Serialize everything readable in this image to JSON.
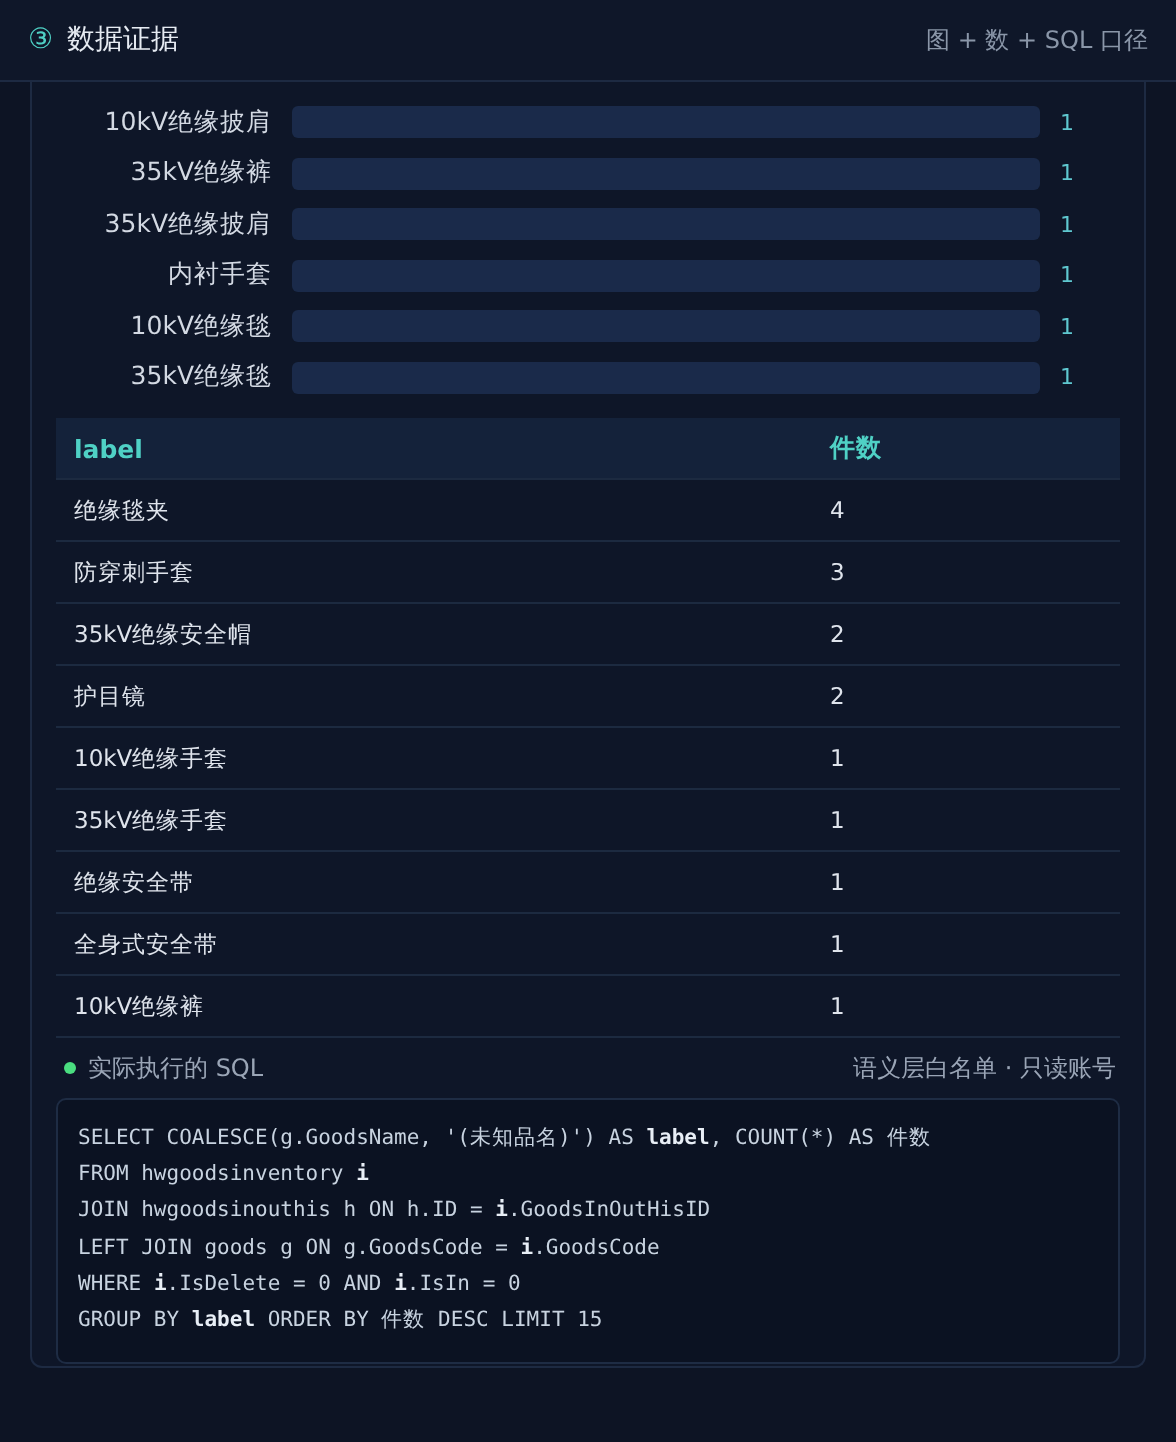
{
  "header": {
    "step": "③",
    "title": "数据证据",
    "subtitle": "图 + 数 + SQL 口径"
  },
  "bars": [
    {
      "label": "10kV绝缘披肩",
      "count": "1"
    },
    {
      "label": "35kV绝缘裤",
      "count": "1"
    },
    {
      "label": "35kV绝缘披肩",
      "count": "1"
    },
    {
      "label": "内衬手套",
      "count": "1"
    },
    {
      "label": "10kV绝缘毯",
      "count": "1"
    },
    {
      "label": "35kV绝缘毯",
      "count": "1"
    }
  ],
  "table": {
    "columns": [
      "label",
      "件数"
    ],
    "rows": [
      [
        "绝缘毯夹",
        "4"
      ],
      [
        "防穿刺手套",
        "3"
      ],
      [
        "35kV绝缘安全帽",
        "2"
      ],
      [
        "护目镜",
        "2"
      ],
      [
        "10kV绝缘手套",
        "1"
      ],
      [
        "35kV绝缘手套",
        "1"
      ],
      [
        "绝缘安全带",
        "1"
      ],
      [
        "全身式安全带",
        "1"
      ],
      [
        "10kV绝缘裤",
        "1"
      ]
    ]
  },
  "sql": {
    "title": "实际执行的 SQL",
    "note": "语义层白名单 · 只读账号",
    "lines": [
      "SELECT COALESCE(g.GoodsName, '(未知品名)') AS **label**, COUNT(*) AS 件数",
      "FROM hwgoodsinventory **i**",
      "JOIN hwgoodsinouthis h ON h.ID = **i**.GoodsInOutHisID",
      "LEFT JOIN goods g ON g.GoodsCode = **i**.GoodsCode",
      "WHERE **i**.IsDelete = 0 AND **i**.IsIn = 0",
      "GROUP BY **label** ORDER BY 件数 DESC LIMIT 15"
    ]
  }
}
